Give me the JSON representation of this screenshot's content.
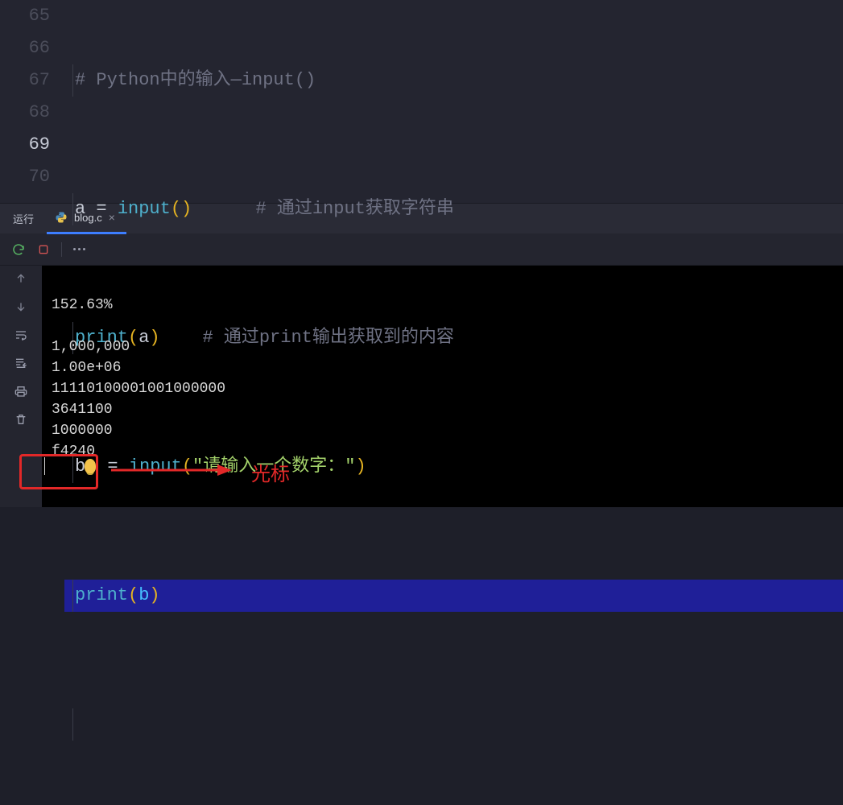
{
  "editor": {
    "lines": [
      {
        "num": "65"
      },
      {
        "num": "66"
      },
      {
        "num": "67"
      },
      {
        "num": "68"
      },
      {
        "num": "69"
      },
      {
        "num": "70"
      }
    ],
    "code": {
      "l65_comment": "# Python中的输入—input()",
      "l66_var": "a",
      "l66_eq": " = ",
      "l66_fn": "input",
      "l66_paren_o": "(",
      "l66_paren_c": ")",
      "l66_cmt": "# 通过input获取字符串",
      "l67_fn": "print",
      "l67_paren_o": "(",
      "l67_arg": "a",
      "l67_paren_c": ")",
      "l67_cmt": "# 通过print输出获取到的内容",
      "l68_var": "b",
      "l68_eq": " = ",
      "l68_fn": "input",
      "l68_paren_o": "(",
      "l68_str": "\"请输入一个数字：\"",
      "l68_paren_c": ")",
      "l69_fn": "print",
      "l69_paren_o": "(",
      "l69_arg": "b",
      "l69_paren_c": ")"
    }
  },
  "panel": {
    "run_label": "运行",
    "tab_label": "blog.c"
  },
  "terminal": {
    "lines": [
      "152.63%",
      "",
      "1,000,000",
      "1.00e+06",
      "11110100001001000000",
      "3641100",
      "1000000",
      "f4240"
    ]
  },
  "annotation": {
    "label": "光标"
  }
}
